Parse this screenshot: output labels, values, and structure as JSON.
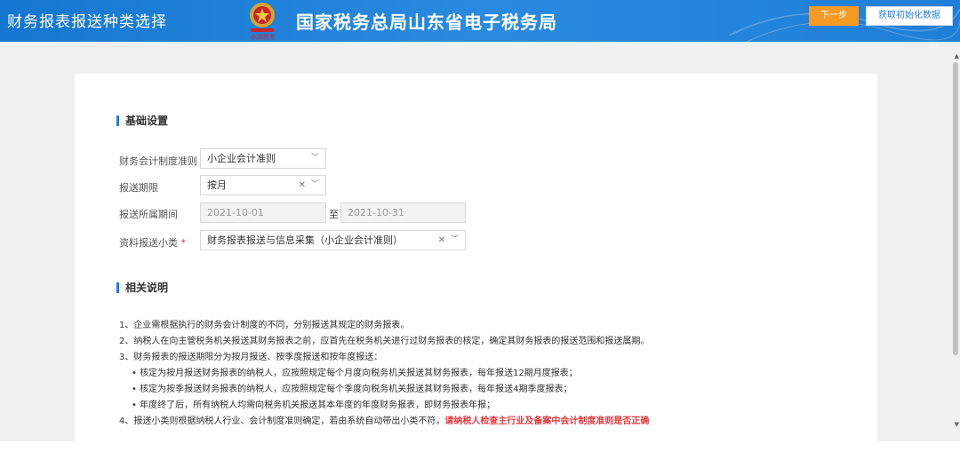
{
  "header": {
    "page_title": "财务报表报送种类选择",
    "org_name": "国家税务总局山东省电子税务局",
    "next_button": "下一步",
    "init_button": "获取初始化数据",
    "emblem_icon": "tax-emblem-icon",
    "bg_color": "#1e7fd8",
    "accent_color": "#f59a23"
  },
  "basic": {
    "section_title": "基础设置",
    "standard_label": "财务会计制度准则",
    "standard_value": "小企业会计准则",
    "period_label": "报送期限",
    "period_value": "按月",
    "range_label": "报送所属期间",
    "range_start": "2021-10-01",
    "range_sep": "至",
    "range_end": "2021-10-31",
    "category_label": "资料报送小类",
    "required_mark": "*",
    "category_value": "财务报表报送与信息采集（小企业会计准则）"
  },
  "notes": {
    "section_title": "相关说明",
    "items": [
      "1、企业需根据执行的财务会计制度的不同，分别报送其规定的财务报表。",
      "2、纳税人在向主管税务机关报送其财务报表之前，应首先在税务机关进行过财务报表的核定，确定其财务报表的报送范围和报送属期。",
      "3、财务报表的报送期限分为按月报送、按季度报送和按年度报送："
    ],
    "sub_items": [
      "• 核定为按月报送财务报表的纳税人，应按照规定每个月度向税务机关报送其财务报表，每年报送12期月度报表；",
      "• 核定为按季报送财务报表的纳税人，应按照规定每个季度向税务机关报送其财务报表，每年报送4期季度报表；",
      "• 年度终了后，所有纳税人均需向税务机关报送其本年度的年度财务报表，即财务报表年报；"
    ],
    "item4_prefix": "4、报送小类则根据纳税人行业、会计制度准则确定，若由系统自动带出小类不符，",
    "item4_warning": "请纳税人检查主行业及备案中会计制度准则是否正确"
  }
}
